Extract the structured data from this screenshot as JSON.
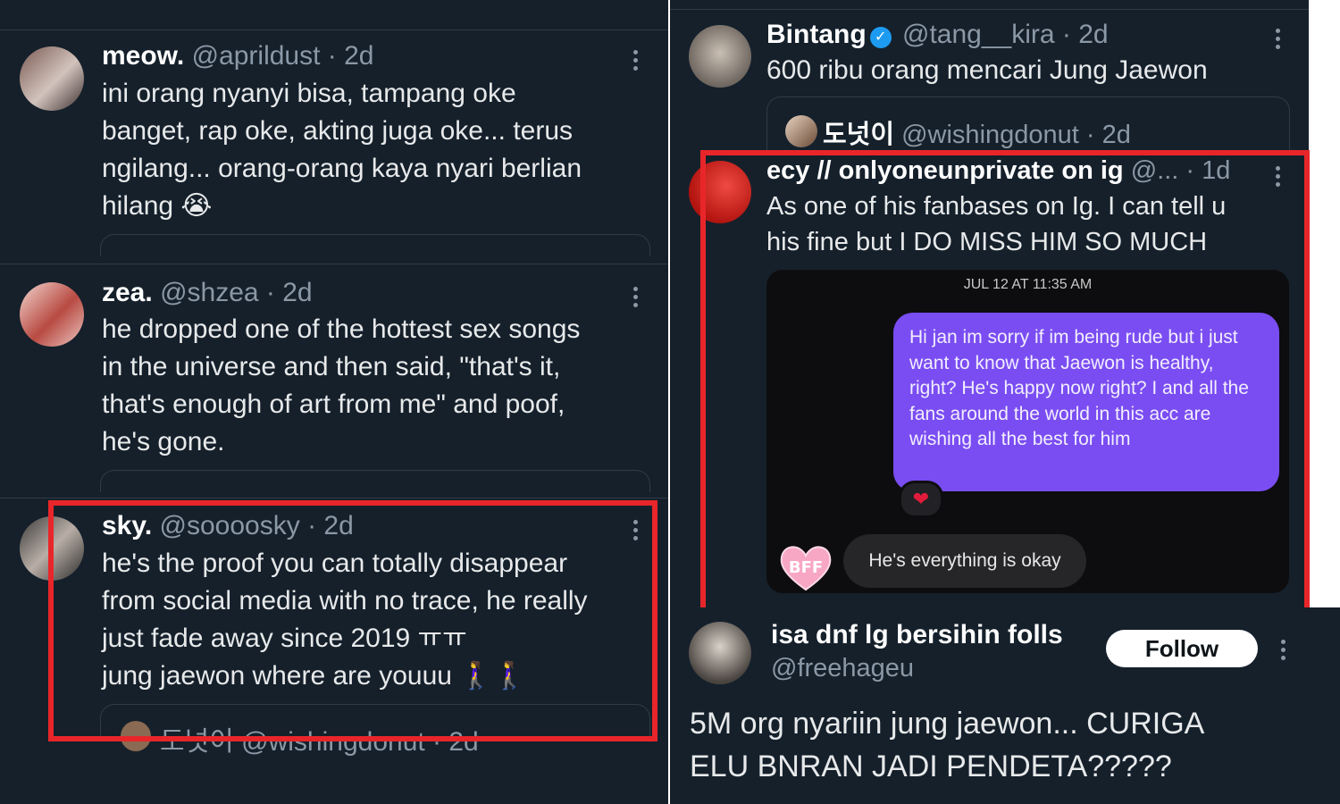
{
  "left_column": {
    "tweets": [
      {
        "name": "meow.",
        "handle": "@aprildust",
        "time": "· 2d",
        "text": "ini orang nyanyi bisa, tampang oke\nbanget, rap oke, akting juga oke... terus\nngilang... orang-orang kaya nyari berlian\nhilang 😭"
      },
      {
        "name": "zea.",
        "handle": "@shzea",
        "time": "· 2d",
        "text": "he dropped one of the hottest sex songs\nin the universe and then said, \"that's it,\nthat's enough of art from me\" and poof,\nhe's gone."
      },
      {
        "name": "sky.",
        "handle": "@soooosky",
        "time": "· 2d",
        "text": "he's the proof you can totally disappear\nfrom social media with no trace, he really\njust fade away since 2019 ㅠㅠ\njung jaewon where are youuu 🚶‍♀️🚶‍♀️",
        "quote_peek": "도넛이 @wishingdonut · 2d"
      }
    ]
  },
  "right_column": {
    "top_tweet": {
      "name": "Bintang",
      "handle": "@tang__kira",
      "time": "· 2d",
      "text": "600 ribu orang mencari Jung Jaewon",
      "quote": {
        "name": "도넛이",
        "handle": "@wishingdonut",
        "time": "· 2d"
      }
    },
    "highlight_tweet": {
      "name": "ecy // onlyoneunprivate on ig",
      "handle": "@...",
      "time": "· 1d",
      "text": "As one of his fanbases on Ig. I can tell u\nhis fine but I DO MISS HIM SO MUCH",
      "chat": {
        "timestamp": "JUL 12 AT 11:35 AM",
        "sent_message": "Hi jan im sorry if im being rude but i just want to know that Jaewon is healthy, right? He's happy now right? I and all the fans around the world in this acc are wishing all the best for him",
        "reaction": "❤",
        "reply": "He's everything is okay",
        "sticker_text": "BFF"
      }
    },
    "bottom_tweet": {
      "name": "isa dnf lg bersihin folls",
      "handle": "@freehageu",
      "follow_label": "Follow",
      "text": "5M org nyariin jung jaewon... CURIGA\nELU BNRAN JADI PENDETA?????"
    }
  },
  "colors": {
    "background": "#15202b",
    "highlight_border": "#e8262a",
    "handle": "#8b98a5",
    "chat_bubble": "#7a4df2",
    "verified": "#1d9bf0"
  }
}
